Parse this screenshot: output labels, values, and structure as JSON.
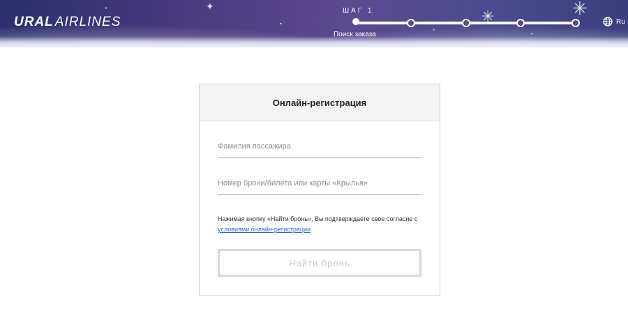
{
  "header": {
    "logo_bold": "URAL",
    "logo_thin": "AIRLINES",
    "step_label": "ШАГ 1",
    "step_subtitle": "Поиск заказа",
    "current_step": 1,
    "total_steps": 5,
    "language": "Ru"
  },
  "form": {
    "title": "Онлайн-регистрация",
    "surname_placeholder": "Фамилия пассажира",
    "booking_placeholder": "Номер брони/билета или карты «Крылья»",
    "consent_text": "Нажимая кнопку «Найти бронь», Вы подтверждаете свое согласие с",
    "consent_link": "условиями онлайн-регистрации",
    "submit_label": "Найти бронь"
  },
  "colors": {
    "header_gradient_start": "#2b2f6e",
    "header_gradient_mid": "#5c4a8e",
    "link": "#2a6dc9",
    "button_disabled_text": "#c8c8c8"
  }
}
